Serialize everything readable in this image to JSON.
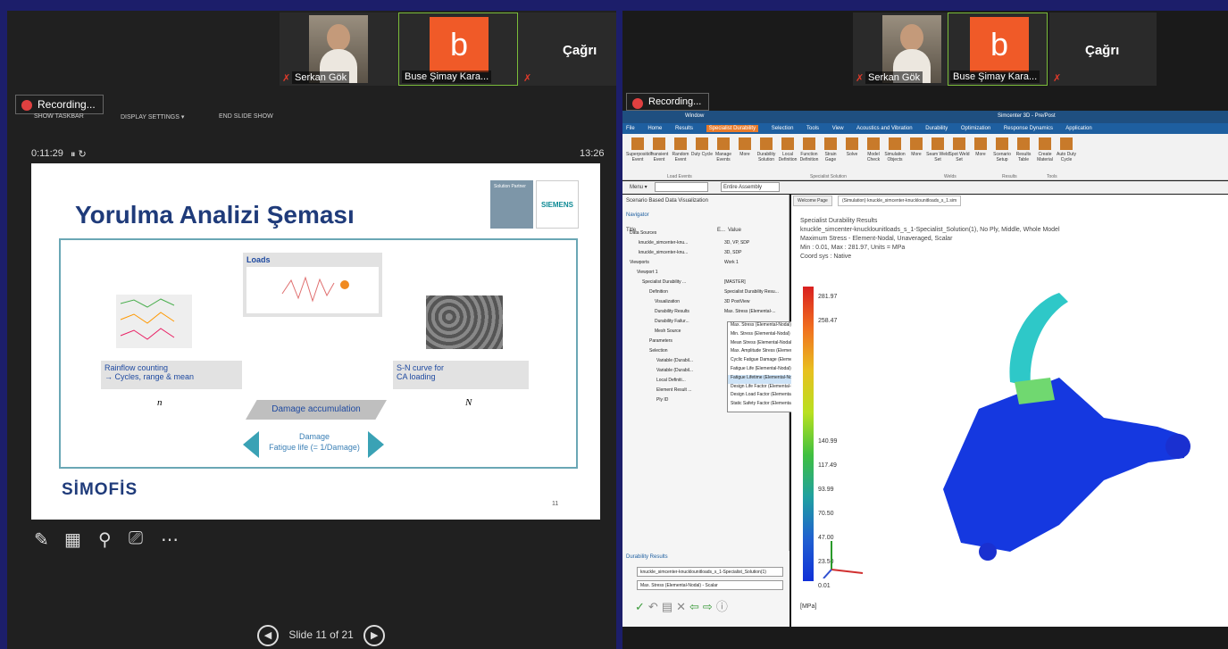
{
  "left": {
    "participants": [
      {
        "name": "Serkan Gök"
      },
      {
        "name": "Buse Şimay Kara..."
      }
    ],
    "cagri": "Çağrı",
    "avatar_letter": "b",
    "recording": "Recording...",
    "controls": {
      "taskbar": "SHOW TASKBAR",
      "display": "DISPLAY SETTINGS ▾",
      "end": "END SLIDE SHOW"
    },
    "elapsed": "0:11:29",
    "clock": "13:26",
    "slide": {
      "title": "Yorulma Analizi Şeması",
      "partner_label": "Solution Partner",
      "siemens": "SIEMENS",
      "loads": "Loads",
      "rainflow": "Rainflow counting\n→ Cycles, range & mean",
      "sn_curve": "S-N curve for\nCA loading",
      "ni_label": "n",
      "Ni_label": "N",
      "damage_acc": "Damage accumulation",
      "damage": "Damage",
      "fatigue_life": "Fatigue life (= 1/Damage)",
      "brand": "SİMOFİS",
      "page_num": "11"
    },
    "slide_nav": "Slide 11 of 21"
  },
  "right": {
    "participants": [
      {
        "name": "Serkan Gök"
      },
      {
        "name": "Buse Şimay Kara..."
      }
    ],
    "cagri": "Çağrı",
    "avatar_letter": "b",
    "recording": "Recording...",
    "app_title": "Simcenter 3D - Pre/Post",
    "window_menu": "Window",
    "tabs": [
      "File",
      "Home",
      "Results",
      "Specialist Durability",
      "Selection",
      "Tools",
      "View",
      "Acoustics and Vibration",
      "Durability",
      "Optimization",
      "Response Dynamics",
      "Application"
    ],
    "ribbon_buttons": [
      "Superposition Event",
      "Transient Event",
      "Random Event",
      "Duty Cycle",
      "Manage Events",
      "More",
      "Durability Solution",
      "Local Definition",
      "Function Definition",
      "Strain Gage",
      "Solve",
      "Model Check",
      "Simulation Objects",
      "More",
      "Seam Weld Set",
      "Spot Weld Set",
      "More",
      "Scenario Setup",
      "Results Table",
      "Create Material",
      "Auto Duty Cycle"
    ],
    "ribbon_groups": [
      "Load Events",
      "Specialist Solution",
      "Welds",
      "Results",
      "Tools"
    ],
    "toolbar": {
      "menu": "Menu ▾",
      "assembly": "Entire Assembly"
    },
    "nav_title": "Scenario Based Data Visualization",
    "navigator": "Navigator",
    "col_title": "Title",
    "col_e": "E...",
    "col_value": "Value",
    "tree": [
      {
        "c1": "Data Sources",
        "c2": ""
      },
      {
        "c1": "knuckle_simcenter-knu...",
        "c2": "3D, VP, SDP"
      },
      {
        "c1": "knuckle_simcenter-knu...",
        "c2": "3D, SDP"
      },
      {
        "c1": "Viewports",
        "c2": "Work 1"
      },
      {
        "c1": "Viewport 1",
        "c2": ""
      },
      {
        "c1": "Specialist Durability ...",
        "c2": "[MASTER]"
      },
      {
        "c1": "Definition",
        "c2": "Specialist Durability Resu..."
      },
      {
        "c1": "Visualization",
        "c2": "3D PostView"
      },
      {
        "c1": "Durability Results",
        "c2": "Max. Stress (Elemental-..."
      },
      {
        "c1": "Durability Failur...",
        "c2": ""
      },
      {
        "c1": "Mesh Source",
        "c2": ""
      },
      {
        "c1": "Parameters",
        "c2": ""
      },
      {
        "c1": "Selection",
        "c2": ""
      },
      {
        "c1": "Variable (Durabil...",
        "c2": ""
      },
      {
        "c1": "Variable (Durabil...",
        "c2": ""
      },
      {
        "c1": "Local Definiti...",
        "c2": ""
      },
      {
        "c1": "Element Result ...",
        "c2": ""
      },
      {
        "c1": "Ply ID",
        "c2": ""
      }
    ],
    "dropdown_options": [
      "Max. Stress (Elemental-Nodal) - Scalar",
      "Min. Stress (Elemental-Nodal) - Scalar",
      "Mean Stress (Elemental-Nodal) - Scalar",
      "Max. Amplitude Stress (Elemental-Nodal) - Scalar",
      "Cyclic Fatigue Damage (Elemental-Nodal) - Scalar",
      "Fatigue Life (Elemental-Nodal) - Scalar",
      "Fatigue Lifetime (Elemental-Nodal) - Scalar",
      "Design Life Factor (Elemental-Nodal) - Scalar",
      "Design Load Factor (Elemental-Nodal) - Scalar",
      "Static Safety Factor (Elemental-Nodal) - Scalar"
    ],
    "dropdown_selected_index": 6,
    "durability_results": "Durability Results",
    "dr_select1": "knuckle_simcenter-knucklounitloads_s_1-Specialist_Solution(1)",
    "dr_select2": "Max. Stress (Elemental-Nodal) - Scalar",
    "graph_tabs": [
      "Welcome Page",
      "(Simulation) knuckle_simcenter-knucklounitloads_s_1.sim"
    ],
    "info": [
      "Specialist Durability Results",
      "knuckle_simcenter-knucklounitloads_s_1-Specialist_Solution(1), No Ply, Middle, Whole Model",
      "Maximum Stress - Element-Nodal, Unaveraged, Scalar",
      "Min : 0.01, Max : 281.97, Units = MPa",
      "Coord sys : Native"
    ],
    "legend_values": [
      "281.97",
      "258.47",
      "140.99",
      "117.49",
      "93.99",
      "70.50",
      "47.00",
      "23.50",
      "0.01"
    ],
    "unit": "[MPa]"
  }
}
